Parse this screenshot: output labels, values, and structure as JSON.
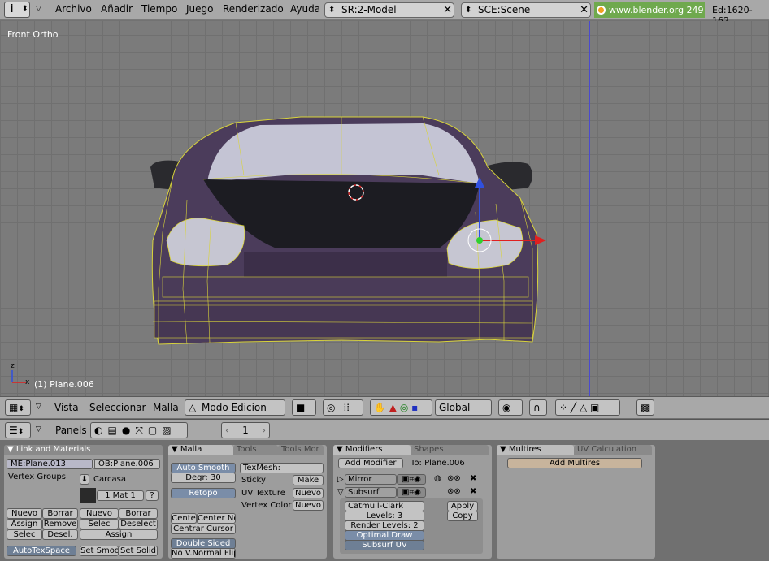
{
  "menu": {
    "items": [
      "Archivo",
      "Añadir",
      "Tiempo",
      "Juego",
      "Renderizado",
      "Ayuda"
    ]
  },
  "screen_field": "SR:2-Model",
  "scene_field": "SCE:Scene",
  "url": "www.blender.org 249",
  "stats": "Ed:1620-162",
  "viewport": {
    "view_label": "Front Ortho",
    "object_label": "(1) Plane.006",
    "axis_z": "z",
    "axis_x": "x"
  },
  "view3d_header": {
    "menus": [
      "Vista",
      "Seleccionar",
      "Malla"
    ],
    "mode": "Modo Edicion",
    "orientation": "Global"
  },
  "buttons_header": {
    "panels_label": "Panels",
    "frame": "1"
  },
  "link_materials": {
    "title": "Link and Materials",
    "mesh": "ME:Plane.013",
    "f": "F",
    "object": "OB:Plane.006",
    "vertex_groups": "Vertex Groups",
    "carcasa": "Carcasa",
    "mat": "1 Mat 1",
    "q": "?",
    "nuevo": "Nuevo",
    "borrar": "Borrar",
    "assign": "Assign",
    "remove": "Remove",
    "selec": "Selec",
    "desel": "Desel.",
    "deselect": "Deselect",
    "autotex": "AutoTexSpace",
    "set_smooth": "Set Smoo",
    "set_solid": "Set Solid"
  },
  "mesh_panel": {
    "tab_malla": "Malla",
    "tab_tools": "Tools",
    "tab_toolsmore": "Tools Mor",
    "auto_smooth": "Auto Smooth",
    "degr": "Degr: 30",
    "retopo": "Retopo",
    "centre": "Cente",
    "center_new": "Center Ne",
    "centrar_cursor": "Centrar Cursor",
    "double_sided": "Double Sided",
    "no_vnormal": "No V.Normal Flip",
    "texmesh": "TexMesh:",
    "sticky": "Sticky",
    "make": "Make",
    "uv_texture": "UV Texture",
    "nuevo": "Nuevo",
    "vertex_color": "Vertex Color"
  },
  "modifiers": {
    "tab_modifiers": "Modifiers",
    "tab_shapes": "Shapes",
    "add_modifier": "Add Modifier",
    "to": "To: Plane.006",
    "mirror": "Mirror",
    "subsurf": "Subsurf",
    "catmull": "Catmull-Clark",
    "levels": "Levels: 3",
    "render_levels": "Render Levels: 2",
    "optimal": "Optimal Draw",
    "subsurf_uv": "Subsurf UV",
    "apply": "Apply",
    "copy": "Copy"
  },
  "multires": {
    "tab_multires": "Multires",
    "tab_uv": "UV Calculation",
    "add_multires": "Add Multires"
  }
}
